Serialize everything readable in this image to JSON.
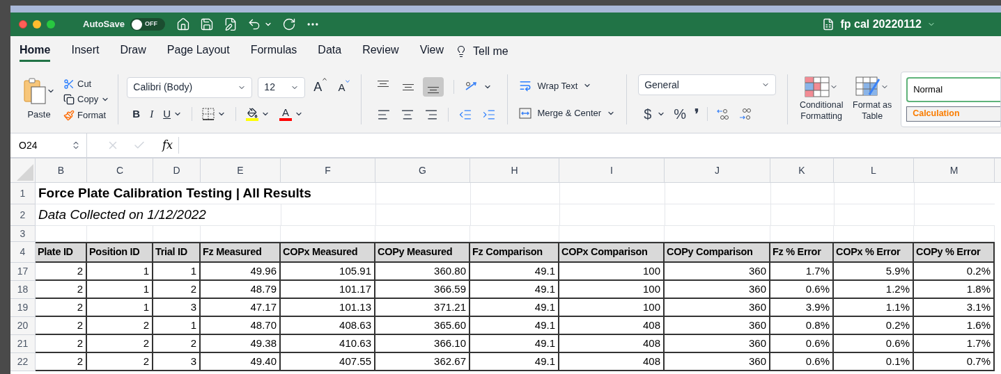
{
  "window": {
    "title": "fp cal 20220112",
    "autosave": {
      "label": "AutoSave",
      "state": "OFF",
      "on": false
    }
  },
  "ribbon_tabs": [
    {
      "label": "Home",
      "selected": true
    },
    {
      "label": "Insert",
      "selected": false
    },
    {
      "label": "Draw",
      "selected": false
    },
    {
      "label": "Page Layout",
      "selected": false
    },
    {
      "label": "Formulas",
      "selected": false
    },
    {
      "label": "Data",
      "selected": false
    },
    {
      "label": "Review",
      "selected": false
    },
    {
      "label": "View",
      "selected": false
    }
  ],
  "tell_me": "Tell me",
  "clipboard": {
    "paste": "Paste",
    "cut": "Cut",
    "copy": "Copy",
    "format": "Format"
  },
  "font": {
    "name": "Calibri (Body)",
    "size": "12",
    "grow": "A",
    "shrink": "A",
    "bold": "B",
    "italic": "I",
    "underline": "U",
    "color_letter": "A"
  },
  "vertical_align": [
    {
      "kind": "top",
      "selected": false
    },
    {
      "kind": "middle",
      "selected": false
    },
    {
      "kind": "bottom",
      "selected": true
    }
  ],
  "wrap_text": "Wrap Text",
  "merge_center": "Merge & Center",
  "number": {
    "format": "General",
    "currency": "$",
    "percent": "%",
    "comma": "❜"
  },
  "conditional_formatting": "Conditional Formatting",
  "format_as_table": "Format as Table",
  "styles": [
    {
      "label": "Normal",
      "kind": "normal"
    },
    {
      "label": "Calculation",
      "kind": "calculation"
    }
  ],
  "formula_bar": {
    "cell_ref": "O24",
    "fx": "fx"
  },
  "sheet": {
    "columns": [
      "B",
      "C",
      "D",
      "E",
      "F",
      "G",
      "H",
      "I",
      "J",
      "K",
      "L",
      "M"
    ],
    "rows": [
      {
        "number": "1",
        "kind": "title",
        "text": "Force Plate Calibration Testing | All Results"
      },
      {
        "number": "2",
        "kind": "subtitle",
        "text": "Data Collected on 1/12/2022"
      },
      {
        "number": "3",
        "kind": "blank"
      },
      {
        "number": "4",
        "kind": "header",
        "cells": [
          "Plate ID",
          "Position ID",
          "Trial ID",
          "Fz Measured",
          "COPx Measured",
          "COPy Measured",
          "Fz Comparison",
          "COPx Comparison",
          "COPy Comparison",
          "Fz % Error",
          "COPx % Error",
          "COPy % Error"
        ]
      },
      {
        "number": "17",
        "kind": "data",
        "cells": [
          "2",
          "1",
          "1",
          "49.96",
          "105.91",
          "360.80",
          "49.1",
          "100",
          "360",
          "1.7%",
          "5.9%",
          "0.2%"
        ]
      },
      {
        "number": "18",
        "kind": "data",
        "cells": [
          "2",
          "1",
          "2",
          "48.79",
          "101.17",
          "366.59",
          "49.1",
          "100",
          "360",
          "0.6%",
          "1.2%",
          "1.8%"
        ]
      },
      {
        "number": "19",
        "kind": "data",
        "cells": [
          "2",
          "1",
          "3",
          "47.17",
          "101.13",
          "371.21",
          "49.1",
          "100",
          "360",
          "3.9%",
          "1.1%",
          "3.1%"
        ]
      },
      {
        "number": "20",
        "kind": "data",
        "cells": [
          "2",
          "2",
          "1",
          "48.70",
          "408.63",
          "365.60",
          "49.1",
          "408",
          "360",
          "0.8%",
          "0.2%",
          "1.6%"
        ]
      },
      {
        "number": "21",
        "kind": "data",
        "cells": [
          "2",
          "2",
          "2",
          "49.38",
          "410.63",
          "366.10",
          "49.1",
          "408",
          "360",
          "0.6%",
          "0.6%",
          "1.7%"
        ]
      },
      {
        "number": "22",
        "kind": "data",
        "cells": [
          "2",
          "2",
          "3",
          "49.40",
          "407.55",
          "362.67",
          "49.1",
          "408",
          "360",
          "0.6%",
          "0.1%",
          "0.7%"
        ]
      }
    ]
  }
}
